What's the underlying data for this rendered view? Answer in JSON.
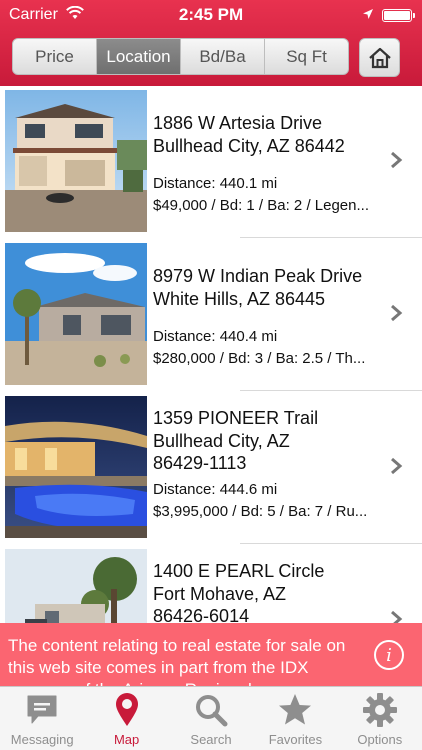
{
  "status_bar": {
    "carrier": "Carrier",
    "time": "2:45 PM"
  },
  "segments": [
    {
      "label": "Price",
      "active": false
    },
    {
      "label": "Location",
      "active": true
    },
    {
      "label": "Bd/Ba",
      "active": false
    },
    {
      "label": "Sq Ft",
      "active": false
    }
  ],
  "listings": [
    {
      "address": [
        "1886 W Artesia Drive",
        "Bullhead City, AZ 86442"
      ],
      "distance": "Distance: 440.1 mi",
      "summary": "$49,000 / Bd: 1 / Ba: 2 / Legen..."
    },
    {
      "address": [
        "8979 W Indian Peak Drive",
        "White Hills, AZ 86445"
      ],
      "distance": "Distance: 440.4 mi",
      "summary": "$280,000 / Bd: 3 / Ba: 2.5 / Th..."
    },
    {
      "address": [
        "1359 PIONEER Trail",
        "Bullhead City, AZ",
        "86429-1113"
      ],
      "distance": "Distance: 444.6 mi",
      "summary": "$3,995,000 / Bd: 5 / Ba: 7 / Ru..."
    },
    {
      "address": [
        "1400 E PEARL Circle",
        "Fort Mohave, AZ",
        "86426-6014"
      ],
      "distance": "",
      "summary": ""
    }
  ],
  "banner": {
    "text": "The content relating to real estate for sale on this web site comes in part from the IDX program of the Arizona Regional"
  },
  "tabs": [
    {
      "label": "Messaging",
      "icon": "messaging-icon",
      "active": false
    },
    {
      "label": "Map",
      "icon": "map-pin-icon",
      "active": true
    },
    {
      "label": "Search",
      "icon": "search-icon",
      "active": false
    },
    {
      "label": "Favorites",
      "icon": "star-icon",
      "active": false
    },
    {
      "label": "Options",
      "icon": "gear-icon",
      "active": false
    }
  ],
  "colors": {
    "accent": "#c81a3a",
    "banner": "#fb6571",
    "tab_inactive": "#8e8e8e"
  }
}
